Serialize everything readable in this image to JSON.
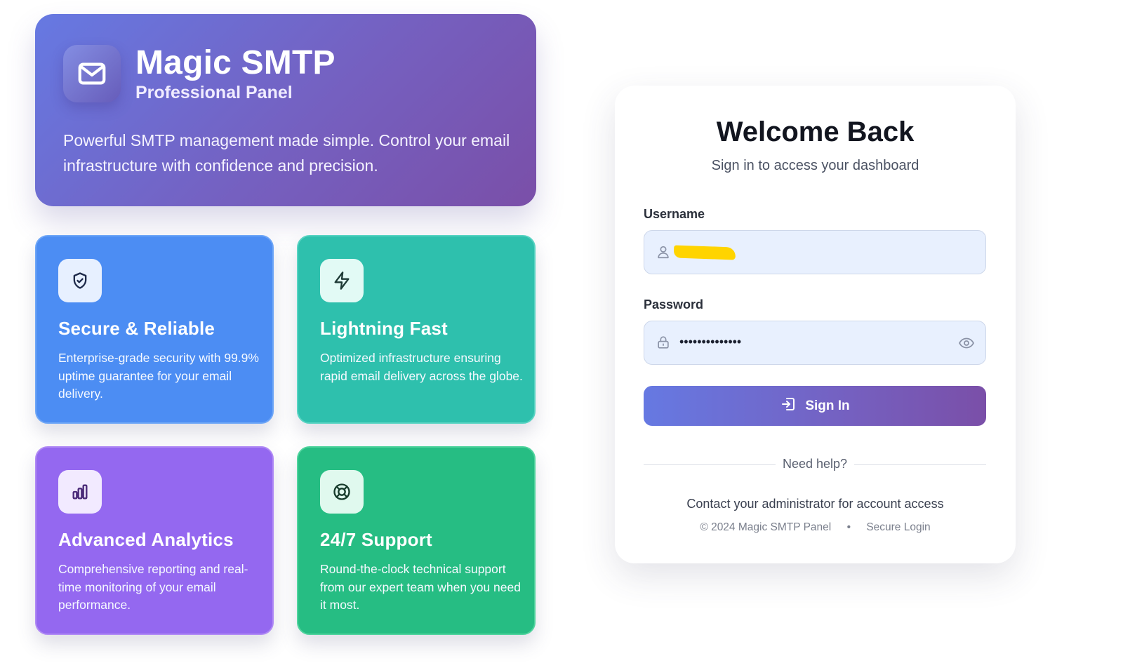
{
  "hero": {
    "title": "Magic SMTP",
    "subtitle": "Professional Panel",
    "description": "Powerful SMTP management made simple. Control your email infrastructure with confidence and precision.",
    "icon": "mail-icon"
  },
  "features": [
    {
      "title": "Secure & Reliable",
      "description": "Enterprise-grade security with 99.9% uptime guarantee for your email delivery.",
      "icon": "shield-check-icon",
      "color": "#4c8df3"
    },
    {
      "title": "Lightning Fast",
      "description": "Optimized infrastructure ensuring rapid email delivery across the globe.",
      "icon": "lightning-icon",
      "color": "#2ec0ad"
    },
    {
      "title": "Advanced Analytics",
      "description": "Comprehensive reporting and real-time monitoring of your email performance.",
      "icon": "bar-chart-icon",
      "color": "#9468f0"
    },
    {
      "title": "24/7 Support",
      "description": "Round-the-clock technical support from our expert team when you need it most.",
      "icon": "lifebuoy-icon",
      "color": "#26bd83"
    }
  ],
  "login": {
    "title": "Welcome Back",
    "subtitle": "Sign in to access your dashboard",
    "username_label": "Username",
    "password_label": "Password",
    "password_value": "••••••••••••••",
    "signin_label": "Sign In",
    "help_text": "Need help?",
    "contact_text": "Contact your administrator for account access",
    "footer_copyright": "© 2024 Magic SMTP Panel",
    "footer_separator": "•",
    "footer_secure": "Secure Login"
  },
  "colors": {
    "gradient_start": "#6679e2",
    "gradient_end": "#7a4fa8",
    "input_background": "#e8f0fe"
  }
}
